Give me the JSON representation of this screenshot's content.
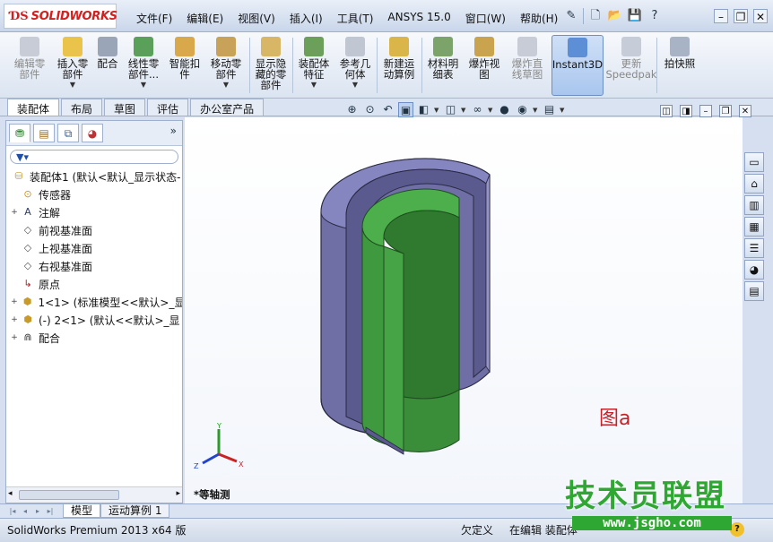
{
  "app": {
    "logo_text": "SOLIDWORKS",
    "logo_ds": "ƊS"
  },
  "menu": [
    "文件(F)",
    "编辑(E)",
    "视图(V)",
    "插入(I)",
    "工具(T)",
    "ANSYS 15.0",
    "窗口(W)",
    "帮助(H)"
  ],
  "ribbon": {
    "edit_part": "编辑零\n部件",
    "insert_part": "插入零\n部件",
    "mate": "配合",
    "linear_pattern": "线性零\n部件...",
    "smart_fasteners": "智能扣\n件",
    "move_component": "移动零\n部件",
    "show_hidden": "显示隐\n藏的零\n部件",
    "assembly_features": "装配体\n特征",
    "reference_geometry": "参考几\n何体",
    "new_motion_study": "新建运\n动算例",
    "bom": "材料明\n细表",
    "exploded_view": "爆炸视\n图",
    "explode_line": "爆炸直\n线草图",
    "instant3d": "Instant3D",
    "update_speedpak": "更新\nSpeedpak",
    "snapshot": "拍快照"
  },
  "tabs": [
    {
      "label": "装配体",
      "active": true
    },
    {
      "label": "布局",
      "active": false
    },
    {
      "label": "草图",
      "active": false
    },
    {
      "label": "评估",
      "active": false
    },
    {
      "label": "办公室产品",
      "active": false
    }
  ],
  "tree": {
    "expand_label": "»",
    "root": "装配体1  (默认<默认_显示状态-",
    "items": [
      {
        "label": "传感器",
        "icon": "sensor-icon",
        "exp": ""
      },
      {
        "label": "注解",
        "icon": "annotation-icon",
        "exp": "+"
      },
      {
        "label": "前视基准面",
        "icon": "plane-icon",
        "exp": ""
      },
      {
        "label": "上视基准面",
        "icon": "plane-icon",
        "exp": ""
      },
      {
        "label": "右视基准面",
        "icon": "plane-icon",
        "exp": ""
      },
      {
        "label": "原点",
        "icon": "origin-icon",
        "exp": ""
      },
      {
        "label": "1<1> (标准模型<<默认>_显",
        "icon": "part-icon",
        "exp": "+"
      },
      {
        "label": "(-) 2<1> (默认<<默认>_显",
        "icon": "part-icon",
        "exp": "+"
      },
      {
        "label": "配合",
        "icon": "mates-icon",
        "exp": "+"
      }
    ]
  },
  "viewport": {
    "figure_label": "图a",
    "view_name": "*等轴测",
    "triad": {
      "x": "X",
      "y": "Y",
      "z": "Z"
    },
    "colors": {
      "outer_side": "#6f6fa6",
      "outer_top": "#8585bf",
      "inner_side": "#3f9a3f",
      "inner_top": "#4caf4c",
      "inner_dark": "#2f7a2f"
    }
  },
  "bottom_tabs": [
    {
      "label": "模型",
      "active": true
    },
    {
      "label": "运动算例 1",
      "active": false
    }
  ],
  "status": {
    "product": "SolidWorks Premium 2013 x64 版",
    "definition": "欠定义",
    "editing": "在编辑 装配体"
  },
  "watermark": {
    "brand": "技术员联盟",
    "url": "www.jsgho.com"
  }
}
